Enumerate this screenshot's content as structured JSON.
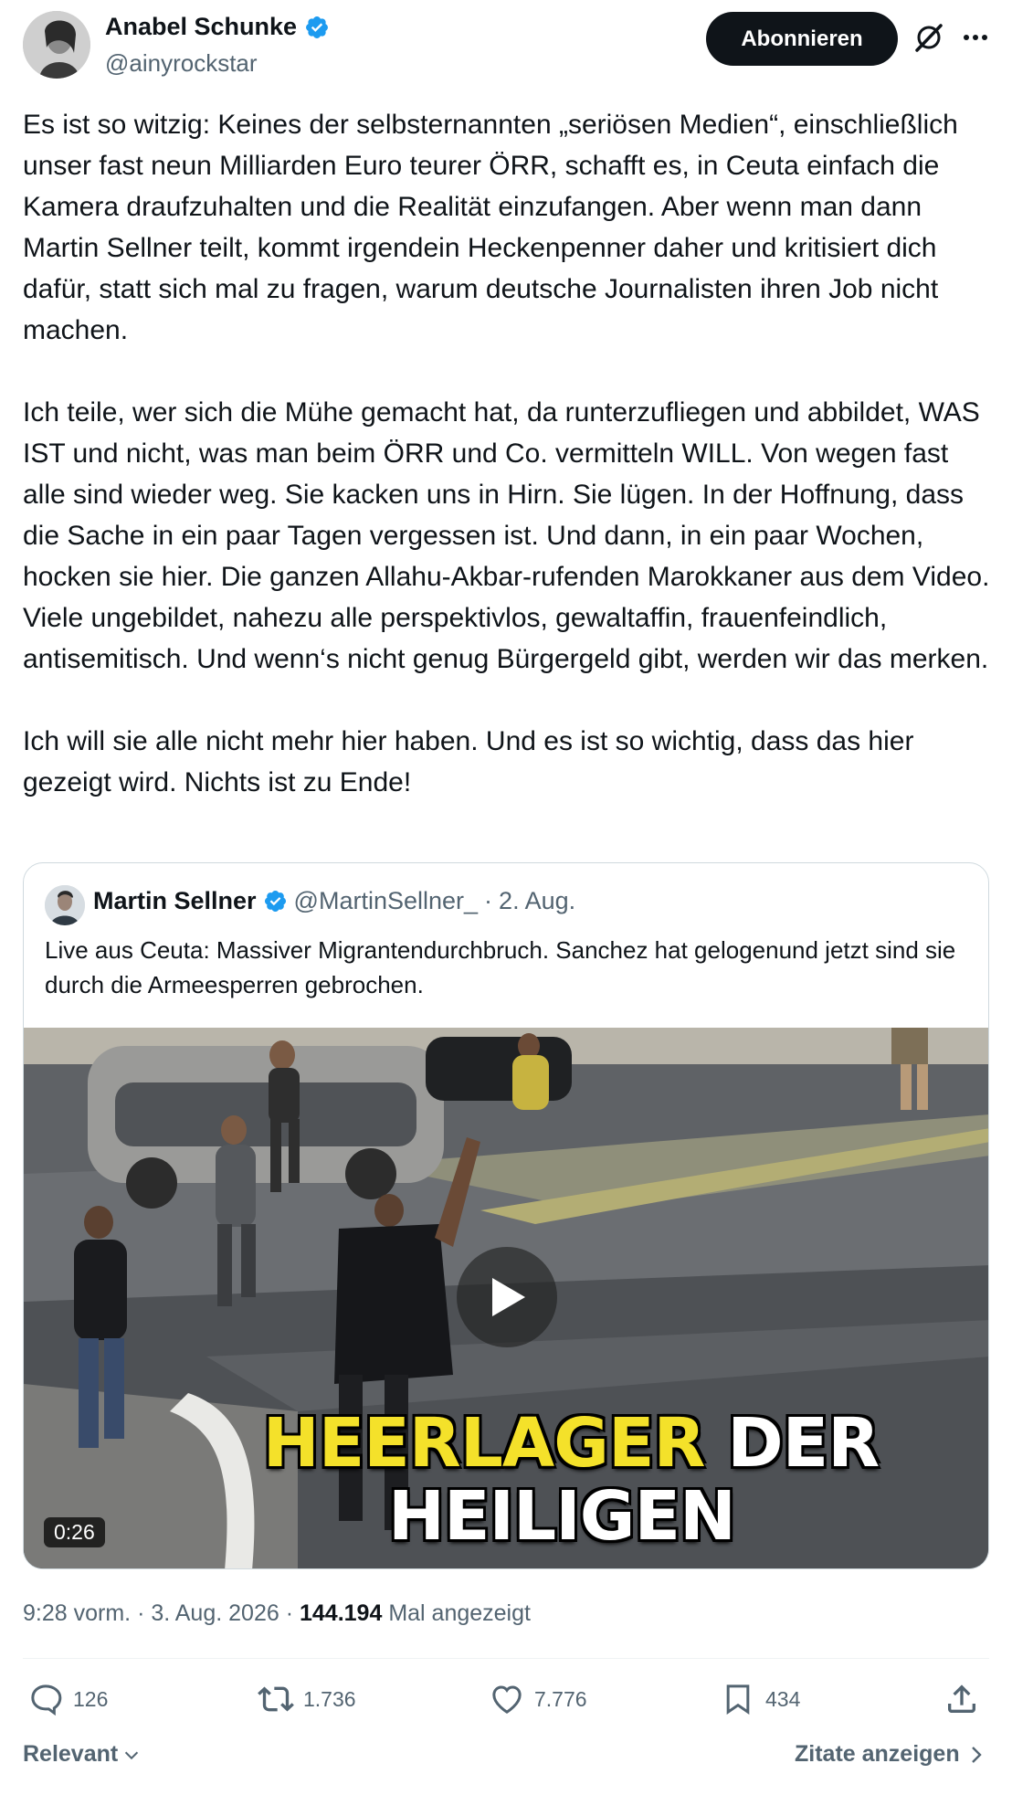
{
  "author": {
    "name": "Anabel Schunke",
    "handle": "@ainyrockstar",
    "verified_icon": "verified-badge-icon"
  },
  "header": {
    "subscribe_label": "Abonnieren",
    "grok_icon": "grok-icon",
    "more_icon": "more-dots-icon"
  },
  "tweet": {
    "text": "Es ist so witzig: Keines der selbsternannten „seriösen Medien“, einschließlich unser fast neun Milliarden Euro teurer ÖRR, schafft es, in Ceuta einfach die Kamera draufzuhalten und die Realität einzufangen. Aber wenn man dann Martin Sellner teilt, kommt irgendein Heckenpenner daher und kritisiert dich dafür, statt sich mal zu fragen, warum deutsche Journalisten ihren Job nicht machen.\n\nIch teile, wer sich die Mühe gemacht hat, da runterzufliegen und abbildet, WAS IST und nicht, was man beim ÖRR und Co. vermitteln WILL. Von wegen fast alle sind wieder weg. Sie kacken uns in Hirn. Sie lügen. In der Hoffnung, dass die Sache in ein paar Tagen vergessen ist. Und dann, in ein paar Wochen, hocken sie hier. Die ganzen Allahu-Akbar-rufenden Marokkaner aus dem Video. Viele ungebildet, nahezu alle perspektivlos, gewaltaffin, frauenfeindlich, antisemitisch. Und wenn‘s nicht genug Bürgergeld gibt, werden wir das merken.\n\nIch will sie alle nicht mehr hier haben. Und es ist so wichtig, dass das hier gezeigt wird. Nichts ist zu Ende!"
  },
  "quote": {
    "name": "Martin Sellner",
    "handle": "@MartinSellner_",
    "separator": "·",
    "date": "2. Aug.",
    "text": "Live aus Ceuta: Massiver Migrantendurchbruch. Sanchez hat gelogenund jetzt sind sie durch die Armeesperren gebrochen.",
    "video": {
      "duration": "0:26",
      "caption_word1": "HEERLAGER",
      "caption_word2": "DER",
      "caption_line2": "HEILIGEN",
      "caption_yellow": "#f4e12a"
    }
  },
  "meta": {
    "time": "9:28 vorm.",
    "sep": "·",
    "date": "3. Aug. 2026",
    "views": "144.194",
    "views_label": "Mal angezeigt"
  },
  "actions": {
    "replies": "126",
    "reposts": "1.736",
    "likes": "7.776",
    "bookmarks": "434"
  },
  "footer": {
    "sort_label": "Relevant",
    "quotes_label": "Zitate anzeigen"
  },
  "colors": {
    "text": "#0f1419",
    "secondary": "#536471",
    "verified": "#1d9bf0",
    "border": "#cfd9de"
  }
}
